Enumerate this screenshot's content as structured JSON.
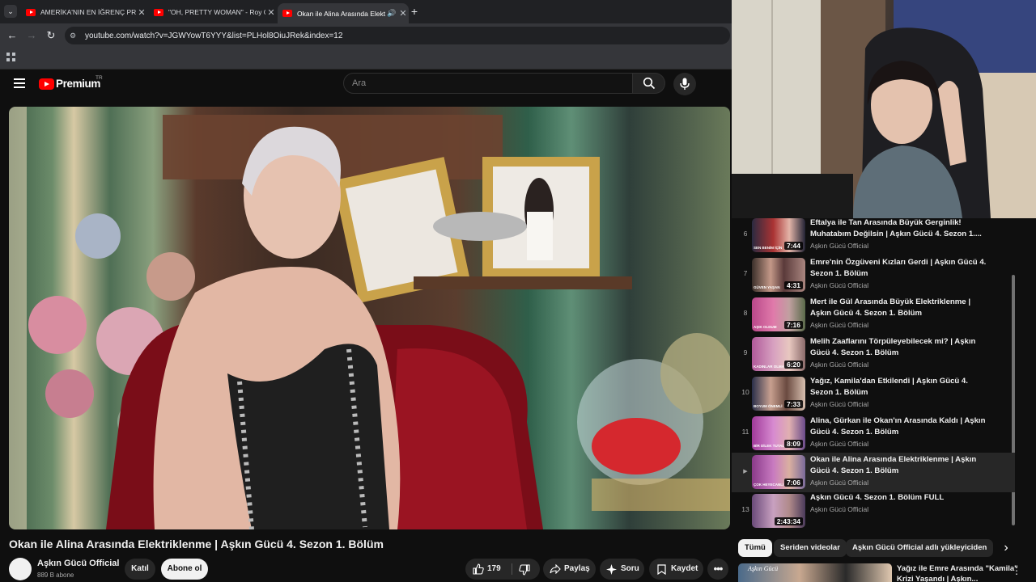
{
  "browser": {
    "tabs": [
      {
        "title": "AMERİKA'NIN EN İĞRENÇ PRO",
        "active": false
      },
      {
        "title": "\"OH, PRETTY WOMAN\" - Roy O",
        "active": false
      },
      {
        "title": "Okan ile Alina Arasında Elekt",
        "active": true
      }
    ],
    "url": "youtube.com/watch?v=JGWYowT6YYY&list=PLHol8OiuJRek&index=12"
  },
  "header": {
    "logo_text": "Premium",
    "region": "TR",
    "search_placeholder": "Ara"
  },
  "video": {
    "title": "Okan ile Alina Arasında Elektriklenme | Aşkın Gücü 4. Sezon 1. Bölüm",
    "channel": "Aşkın Gücü Official",
    "subscribers": "889 B abone",
    "join_label": "Katıl",
    "subscribe_label": "Abone ol",
    "likes": "179",
    "share_label": "Paylaş",
    "ask_label": "Soru",
    "save_label": "Kaydet"
  },
  "playlist": {
    "items": [
      {
        "index": "6",
        "title": "Eftalya ile Tan Arasında Büyük Gerginlik! Muhatabım Değilsin | Aşkın Gücü 4. Sezon 1....",
        "channel": "Aşkın Gücü Official",
        "duration": "7:44",
        "overlay": "SEN BENİM İÇİN",
        "active": false
      },
      {
        "index": "7",
        "title": "Emre'nin Özgüveni Kızları Gerdi | Aşkın Gücü 4. Sezon 1. Bölüm",
        "channel": "Aşkın Gücü Official",
        "duration": "4:31",
        "overlay": "GÜVEN YAŞAN",
        "active": false
      },
      {
        "index": "8",
        "title": "Mert ile Gül Arasında Büyük Elektriklenme | Aşkın Gücü 4. Sezon 1. Bölüm",
        "channel": "Aşkın Gücü Official",
        "duration": "7:16",
        "overlay": "AŞIK OLDUM",
        "active": false
      },
      {
        "index": "9",
        "title": "Melih Zaaflarını Törpüleyebilecek mi? | Aşkın Gücü 4. Sezon 1. Bölüm",
        "channel": "Aşkın Gücü Official",
        "duration": "6:20",
        "overlay": "KADINLAR OLMAZ",
        "active": false
      },
      {
        "index": "10",
        "title": "Yağız, Kamila'dan Etkilendi | Aşkın Gücü 4. Sezon 1. Bölüm",
        "channel": "Aşkın Gücü Official",
        "duration": "7:33",
        "overlay": "BOYUM ÖNEMLİ",
        "active": false
      },
      {
        "index": "11",
        "title": "Alina, Gürkan ile Okan'ın Arasında Kaldı | Aşkın Gücü 4. Sezon 1. Bölüm",
        "channel": "Aşkın Gücü Official",
        "duration": "8:09",
        "overlay": "BİR DİLEK TUTALIM",
        "active": false
      },
      {
        "index": "▶",
        "title": "Okan ile Alina Arasında Elektriklenme | Aşkın Gücü 4. Sezon 1. Bölüm",
        "channel": "Aşkın Gücü Official",
        "duration": "7:06",
        "overlay": "ÇOK HEYECANLI",
        "active": true
      },
      {
        "index": "13",
        "title": "Aşkın Gücü 4. Sezon 1. Bölüm FULL",
        "channel": "Aşkın Gücü Official",
        "duration": "2:43:34",
        "overlay": "",
        "active": false
      }
    ]
  },
  "chips": [
    "Tümü",
    "Seriden videolar",
    "Aşkın Gücü Official adlı yükleyiciden"
  ],
  "recommendation": {
    "title": "Yağız ile Emre Arasında \"Kamila\" Krizi Yaşandı | Aşkın...",
    "overlay": "Aşkın Gücü"
  },
  "colors": {
    "accent": "#ff0000",
    "background": "#0f0f0f"
  }
}
